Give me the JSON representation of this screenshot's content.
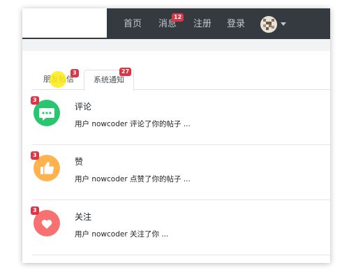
{
  "nav": {
    "items": [
      {
        "label": "首页"
      },
      {
        "label": "消息",
        "badge": "12"
      },
      {
        "label": "注册"
      },
      {
        "label": "登录"
      }
    ],
    "avatar_icon": "pixel-avatar-icon",
    "dropdown_icon": "caret-down-icon"
  },
  "tabs": [
    {
      "label": "朋友私信",
      "badge": "3"
    },
    {
      "label": "系统通知",
      "badge": "27",
      "active": true
    }
  ],
  "notices": [
    {
      "title": "评论",
      "text": "用户 nowcoder 评论了你的帖子 ...",
      "badge": "3",
      "icon": "comment-icon",
      "color": "#28c76f"
    },
    {
      "title": "赞",
      "text": "用户 nowcoder 点赞了你的帖子 ...",
      "badge": "3",
      "icon": "thumbs-up-icon",
      "color": "#ffb24d"
    },
    {
      "title": "关注",
      "text": "用户 nowcoder 关注了你 ...",
      "badge": "3",
      "icon": "heart-icon",
      "color": "#f87171"
    }
  ],
  "colors": {
    "nav_bg": "#343a40",
    "badge": "#dc3545",
    "nav_text": "#c4c7ca"
  }
}
